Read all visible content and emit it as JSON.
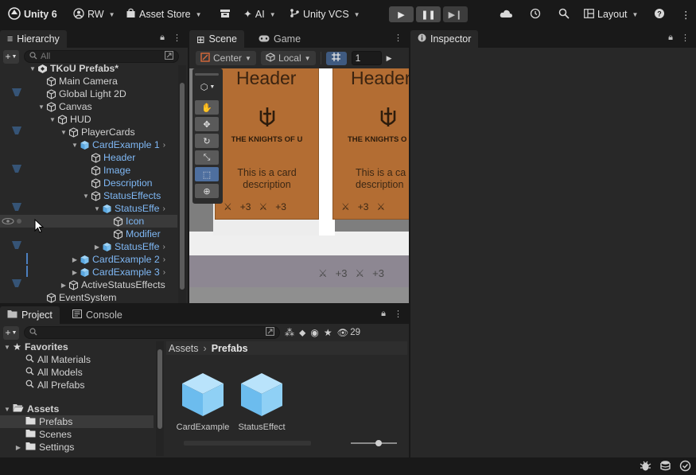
{
  "toolbar": {
    "unity_label": "Unity 6",
    "account_label": "RW",
    "asset_store_label": "Asset Store",
    "ai_label": "AI",
    "vcs_label": "Unity VCS",
    "layout_label": "Layout"
  },
  "hierarchy": {
    "tab_label": "Hierarchy",
    "search_placeholder": "All",
    "items": [
      {
        "label": "TKoU Prefabs*",
        "kind": "scene"
      },
      {
        "label": "Main Camera",
        "kind": "go"
      },
      {
        "label": "Global Light 2D",
        "kind": "go"
      },
      {
        "label": "Canvas",
        "kind": "go"
      },
      {
        "label": "HUD",
        "kind": "go"
      },
      {
        "label": "PlayerCards",
        "kind": "go"
      },
      {
        "label": "CardExample 1",
        "kind": "prefab"
      },
      {
        "label": "Header",
        "kind": "prefab-child"
      },
      {
        "label": "Image",
        "kind": "prefab-child"
      },
      {
        "label": "Description",
        "kind": "prefab-child"
      },
      {
        "label": "StatusEffects",
        "kind": "prefab-child"
      },
      {
        "label": "StatusEffe",
        "kind": "prefab"
      },
      {
        "label": "Icon",
        "kind": "prefab-child"
      },
      {
        "label": "Modifier",
        "kind": "prefab-child"
      },
      {
        "label": "StatusEffe",
        "kind": "prefab"
      },
      {
        "label": "CardExample 2",
        "kind": "prefab"
      },
      {
        "label": "CardExample 3",
        "kind": "prefab"
      },
      {
        "label": "ActiveStatusEffects",
        "kind": "go"
      },
      {
        "label": "EventSystem",
        "kind": "go"
      }
    ]
  },
  "scene": {
    "tabs": [
      "Scene",
      "Game"
    ],
    "pivot_label": "Center",
    "space_label": "Local",
    "grid_value": "1",
    "card_header": "Header",
    "card_brand_1": "THE KNIGHTS OF U",
    "card_brand_2": "THE KNIGHTS O",
    "card_desc_1": "This is a card\ndescription",
    "card_desc_2": "This is a ca\ndescription",
    "effect_value_1": "+3",
    "effect_value_2": "+3",
    "effect_value_3": "+3",
    "effect_value_4": "+3"
  },
  "inspector": {
    "tab_label": "Inspector"
  },
  "project": {
    "tabs": [
      "Project",
      "Console"
    ],
    "hidden_count": "29",
    "favorites_label": "Favorites",
    "favorites": [
      "All Materials",
      "All Models",
      "All Prefabs"
    ],
    "assets_label": "Assets",
    "folders": [
      "Prefabs",
      "Scenes",
      "Settings"
    ],
    "breadcrumb": [
      "Assets",
      "Prefabs"
    ],
    "assets": [
      {
        "name": "CardExample"
      },
      {
        "name": "StatusEffect"
      }
    ],
    "slider_fraction": 0.6
  },
  "colors": {
    "accent_blue": "#4c7fbf",
    "prefab_text": "#7fb8f5",
    "card_orange": "#b36d33"
  }
}
